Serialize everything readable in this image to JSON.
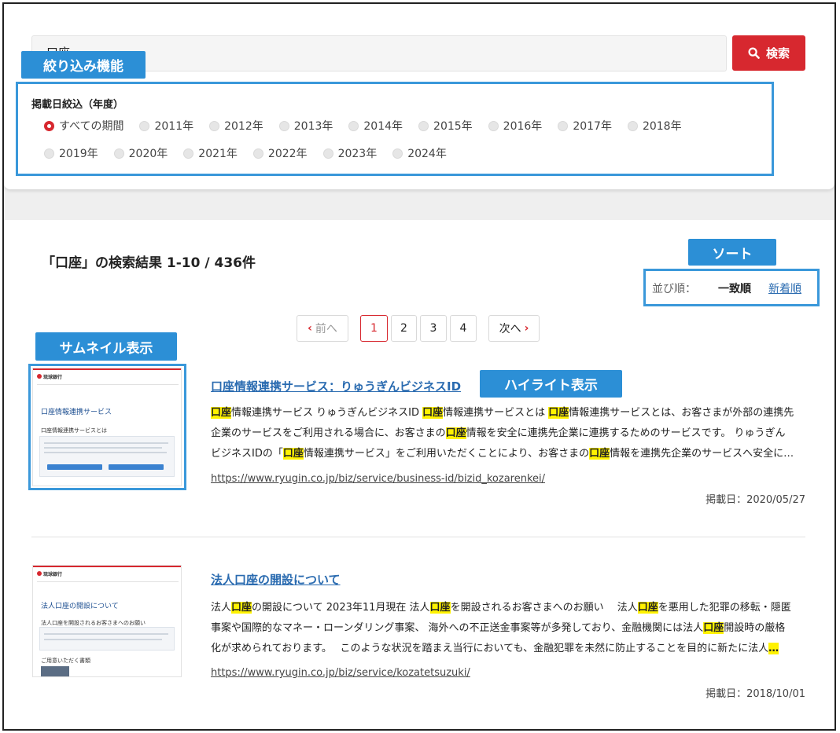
{
  "search": {
    "value": "口座",
    "button_label": "検索",
    "button_icon": "search-icon"
  },
  "annotations": {
    "filter": "絞り込み機能",
    "sort": "ソート",
    "thumbnail": "サムネイル表示",
    "highlight": "ハイライト表示"
  },
  "filter": {
    "title": "掲載日絞込（年度）",
    "selected": "すべての期間",
    "options_row1": [
      "すべての期間",
      "2011年",
      "2012年",
      "2013年",
      "2014年",
      "2015年",
      "2016年",
      "2017年",
      "2018年"
    ],
    "options_row2": [
      "2019年",
      "2020年",
      "2021年",
      "2022年",
      "2023年",
      "2024年"
    ]
  },
  "results": {
    "heading": "「口座」の検索結果 1-10 / 436件",
    "sort": {
      "label": "並び順：",
      "current": "一致順",
      "alternative": "新着順"
    },
    "pagination": {
      "prev": "前へ",
      "pages": [
        "1",
        "2",
        "3",
        "4"
      ],
      "current_page": "1",
      "next": "次へ"
    },
    "items": [
      {
        "title": "口座情報連携サービス：りゅうぎんビジネスID",
        "snippet_lines": [
          [
            [
              "口座",
              true
            ],
            [
              "情報連携サービス りゅうぎんビジネスID ",
              false
            ],
            [
              "口座",
              true
            ],
            [
              "情報連携サービスとは ",
              false
            ],
            [
              "口座",
              true
            ],
            [
              "情報連携サービスとは、お客さまが外部の連携先",
              false
            ]
          ],
          [
            [
              "企業のサービスをご利用される場合に、お客さまの",
              false
            ],
            [
              "口座",
              true
            ],
            [
              "情報を安全に連携先企業に連携するためのサービスです。 りゅうぎん",
              false
            ]
          ],
          [
            [
              "ビジネスIDの「",
              false
            ],
            [
              "口座",
              true
            ],
            [
              "情報連携サービス」をご利用いただくことにより、お客さまの",
              false
            ],
            [
              "口座",
              true
            ],
            [
              "情報を連携先企業のサービスへ安全に…",
              false
            ]
          ]
        ],
        "url": "https://www.ryugin.co.jp/biz/service/business-id/bizid_kozarenkei/",
        "date": "掲載日：2020/05/27",
        "thumb": {
          "logo": "琉球銀行",
          "title": "口座情報連携サービス",
          "subtitle": "口座情報連携サービスとは"
        }
      },
      {
        "title": "法人口座の開設について",
        "snippet_lines": [
          [
            [
              "法人",
              false
            ],
            [
              "口座",
              true
            ],
            [
              "の開設について 2023年11月現在 法人",
              false
            ],
            [
              "口座",
              true
            ],
            [
              "を開設されるお客さまへのお願い　 法人",
              false
            ],
            [
              "口座",
              true
            ],
            [
              "を悪用した犯罪の移転・隠匿",
              false
            ]
          ],
          [
            [
              "事案や国際的なマネー・ローンダリング事案、 海外への不正送金事案等が多発しており、金融機関には法人",
              false
            ],
            [
              "口座",
              true
            ],
            [
              "開設時の厳格",
              false
            ]
          ],
          [
            [
              "化が求められております。　 このような状況を踏まえ当行においても、金融犯罪を未然に防止することを目的に新たに法人",
              false
            ],
            [
              "…",
              true
            ]
          ]
        ],
        "url": "https://www.ryugin.co.jp/biz/service/kozatetsuzuki/",
        "date": "掲載日：2018/10/01",
        "thumb": {
          "logo": "琉球銀行",
          "title": "法人口座の開設について",
          "subtitle": "法人口座を開設されるお客さまへのお願い",
          "subtitle2": "ご用意いただく書類"
        }
      }
    ]
  },
  "colors": {
    "accent_red": "#d7282f",
    "annotation_blue": "#2c8fd6",
    "link_blue": "#2a6bb0",
    "highlight_yellow": "#fff200"
  }
}
